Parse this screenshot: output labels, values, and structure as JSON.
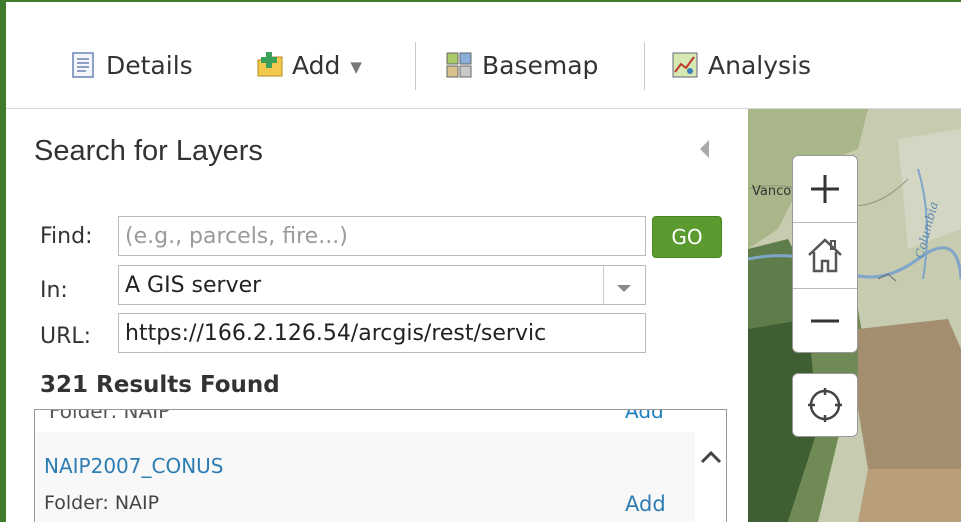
{
  "toolbar": {
    "items": [
      {
        "label": "Details",
        "icon": "details-icon"
      },
      {
        "label": "Add",
        "icon": "add-layer-icon"
      },
      {
        "label": "Basemap",
        "icon": "basemap-icon"
      },
      {
        "label": "Analysis",
        "icon": "analysis-icon"
      }
    ]
  },
  "panel": {
    "title": "Search for Layers",
    "find_label": "Find:",
    "find_placeholder": "(e.g., parcels, fire...)",
    "go_label": "GO",
    "in_label": "In:",
    "in_value": "A GIS server",
    "url_label": "URL:",
    "url_value": "https://166.2.126.54/arcgis/rest/servic",
    "results_count": "321 Results Found"
  },
  "results": {
    "partial_item": {
      "folder": "Folder: NAIP",
      "add": "Add"
    },
    "items": [
      {
        "name": "NAIP2007_CONUS",
        "folder": "Folder: NAIP",
        "add": "Add"
      }
    ]
  },
  "map": {
    "label": "Vancouver",
    "river_label": "Columbia",
    "controls": [
      "zoom-in-icon",
      "home-icon",
      "zoom-out-icon",
      "locate-icon"
    ]
  },
  "colors": {
    "accent_green": "#5a9a2e",
    "link_blue": "#2d7db3",
    "border_green": "#3e7b2a"
  }
}
